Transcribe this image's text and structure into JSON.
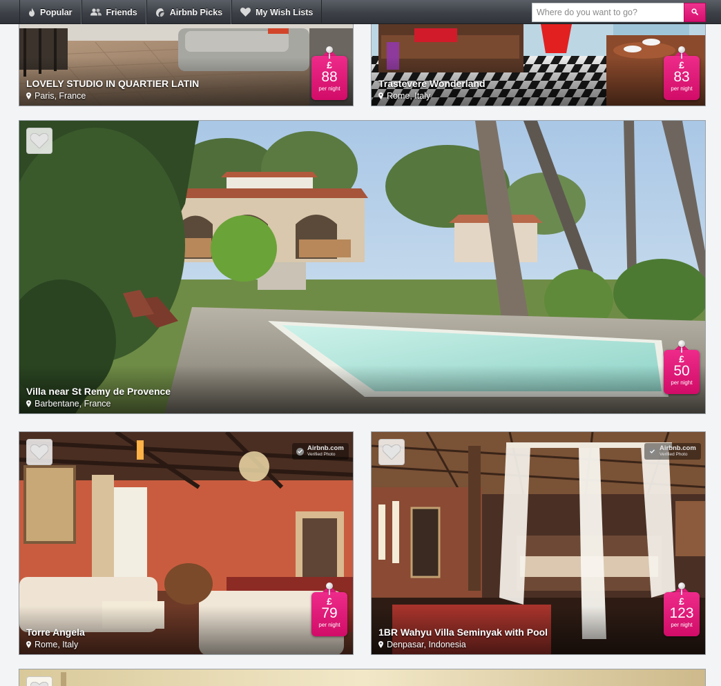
{
  "nav": {
    "tabs": [
      {
        "label": "Popular",
        "icon": "flame-icon"
      },
      {
        "label": "Friends",
        "icon": "friends-icon"
      },
      {
        "label": "Airbnb Picks",
        "icon": "airbnb-picks-icon"
      },
      {
        "label": "My Wish Lists",
        "icon": "heart-icon"
      }
    ],
    "search": {
      "placeholder": "Where do you want to go?",
      "value": ""
    }
  },
  "listings": [
    {
      "title": "LOVELY STUDIO IN QUARTIER LATIN",
      "location": "Paris, France",
      "currency": "£",
      "price": "88",
      "per_night": "per night",
      "wishlist_visible": false,
      "verified_photo": false
    },
    {
      "title": "Trastevere Wonderland",
      "location": "Rome, Italy",
      "currency": "£",
      "price": "83",
      "per_night": "per night",
      "wishlist_visible": false,
      "verified_photo": false
    },
    {
      "title": "Villa near St Remy de Provence",
      "location": "Barbentane, France",
      "currency": "£",
      "price": "50",
      "per_night": "per night",
      "wishlist_visible": true,
      "verified_photo": false
    },
    {
      "title": "Torre Angela",
      "location": "Rome, Italy",
      "currency": "£",
      "price": "79",
      "per_night": "per night",
      "wishlist_visible": true,
      "verified_photo": true
    },
    {
      "title": "1BR Wahyu Villa Seminyak with Pool",
      "location": "Denpasar, Indonesia",
      "currency": "£",
      "price": "123",
      "per_night": "per night",
      "wishlist_visible": true,
      "verified_photo": true
    }
  ],
  "verified": {
    "brand": "Airbnb.com",
    "label": "Verified Photo"
  },
  "colors": {
    "accent": "#e0187a",
    "nav": "#3d4147",
    "page_bg": "#f2f4f6"
  }
}
